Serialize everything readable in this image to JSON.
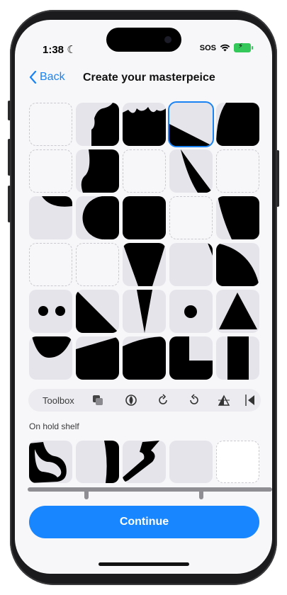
{
  "status_bar": {
    "time": "1:38",
    "moon": "☾",
    "sos": "SOS"
  },
  "nav": {
    "back_label": "Back",
    "title": "Create your masterpeice"
  },
  "toolbox": {
    "label": "Toolbox",
    "tools": [
      "duplicate-icon",
      "fill-icon",
      "rotate-clockwise-icon",
      "rotate-counterclockwise-icon",
      "flip-vertical-icon",
      "flip-horizontal-icon"
    ]
  },
  "shelf": {
    "label": "On hold shelf"
  },
  "continue_label": "Continue",
  "colors": {
    "accent": "#1786ff",
    "tile": "#e4e4ea",
    "shape": "#000000",
    "battery": "#34c759"
  }
}
